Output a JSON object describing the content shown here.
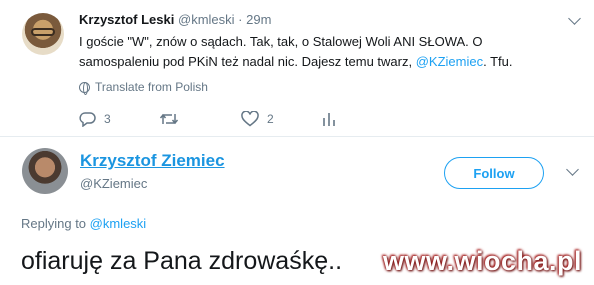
{
  "tweet": {
    "author_name": "Krzysztof Leski",
    "author_handle": "@kmleski",
    "separator": " · ",
    "time": "29m",
    "text_part1": "I goście \"W\", znów o sądach. Tak, tak, o Stalowej Woli ANI SŁOWA. O samospaleniu pod PKiN też nadal nic. Dajesz temu twarz, ",
    "text_mention": "@KZiemiec",
    "text_part2": ". Tfu.",
    "translate_label": "Translate from Polish",
    "reply_count": "3",
    "like_count": "2",
    "icons": [
      "reply-icon",
      "retweet-icon",
      "like-icon",
      "analytics-icon",
      "globe-icon",
      "chevron-down-icon"
    ]
  },
  "reply": {
    "author_name": "Krzysztof Ziemiec",
    "author_handle": "@KZiemiec",
    "follow_label": "Follow",
    "replying_prefix": "Replying to ",
    "replying_mention": "@kmleski",
    "text": "ofiaruję za Pana zdrowaśkę.."
  },
  "watermark": "www.wiocha.pl",
  "colors": {
    "accent": "#1da1f2",
    "text": "#14171a",
    "secondary": "#657786",
    "divider": "#e6ecf0"
  }
}
